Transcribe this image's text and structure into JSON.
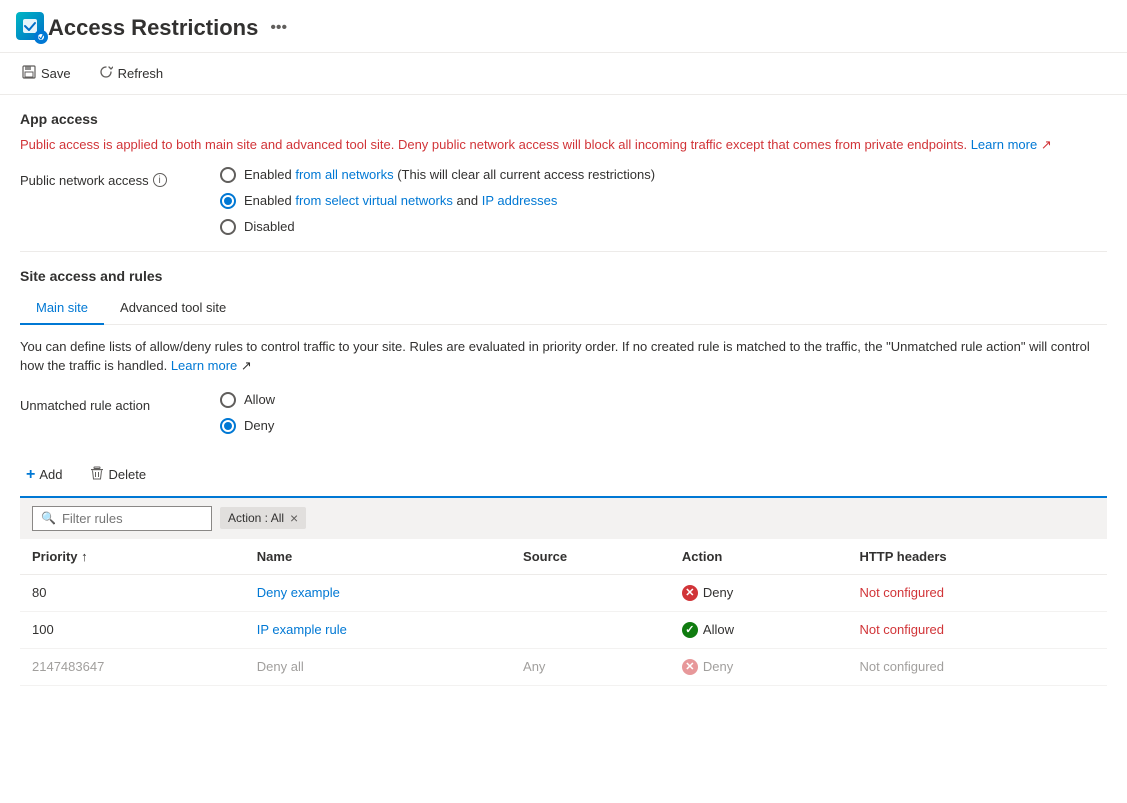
{
  "header": {
    "title": "Access Restrictions",
    "more_icon": "•••"
  },
  "toolbar": {
    "save_label": "Save",
    "refresh_label": "Refresh"
  },
  "app_access": {
    "section_title": "App access",
    "info_text_prefix": "Public access is applied to both main site and advanced tool site. Deny public network access will block all incoming traffic except that comes from private endpoints.",
    "learn_more_label": "Learn more"
  },
  "public_network_access": {
    "label": "Public network access",
    "options": [
      {
        "id": "opt1",
        "label_before": "Enabled ",
        "label_highlight1": "from all networks",
        "label_after": " (This will clear all current access restrictions)",
        "selected": false
      },
      {
        "id": "opt2",
        "label_before": "Enabled ",
        "label_highlight1": "from select virtual networks",
        "label_middle": " and ",
        "label_highlight2": "IP addresses",
        "selected": true
      },
      {
        "id": "opt3",
        "label_before": "Disabled",
        "selected": false
      }
    ]
  },
  "site_access": {
    "section_title": "Site access and rules",
    "tabs": [
      {
        "id": "main",
        "label": "Main site",
        "active": true
      },
      {
        "id": "advanced",
        "label": "Advanced tool site",
        "active": false
      }
    ],
    "description": "You can define lists of allow/deny rules to control traffic to your site. Rules are evaluated in priority order. If no created rule is matched to the traffic, the \"Unmatched rule action\" will control how the traffic is handled.",
    "learn_more_label": "Learn more"
  },
  "unmatched_rule_action": {
    "label": "Unmatched rule action",
    "options": [
      {
        "id": "ura1",
        "label": "Allow",
        "selected": false
      },
      {
        "id": "ura2",
        "label": "Deny",
        "selected": true
      }
    ]
  },
  "rules_toolbar": {
    "add_label": "Add",
    "delete_label": "Delete"
  },
  "filter": {
    "placeholder": "Filter rules",
    "tag_label": "Action : All",
    "tag_close": "×"
  },
  "table": {
    "columns": [
      {
        "id": "priority",
        "label": "Priority ↑"
      },
      {
        "id": "name",
        "label": "Name"
      },
      {
        "id": "source",
        "label": "Source"
      },
      {
        "id": "action",
        "label": "Action"
      },
      {
        "id": "http_headers",
        "label": "HTTP headers"
      }
    ],
    "rows": [
      {
        "priority": "80",
        "name": "Deny example",
        "source": "",
        "action": "Deny",
        "action_type": "deny",
        "http_headers": "Not configured",
        "headers_type": "error",
        "disabled": false
      },
      {
        "priority": "100",
        "name": "IP example rule",
        "source": "",
        "action": "Allow",
        "action_type": "allow",
        "http_headers": "Not configured",
        "headers_type": "error",
        "disabled": false
      },
      {
        "priority": "2147483647",
        "name": "Deny all",
        "source": "Any",
        "action": "Deny",
        "action_type": "deny-gray",
        "http_headers": "Not configured",
        "headers_type": "gray",
        "disabled": true
      }
    ]
  }
}
